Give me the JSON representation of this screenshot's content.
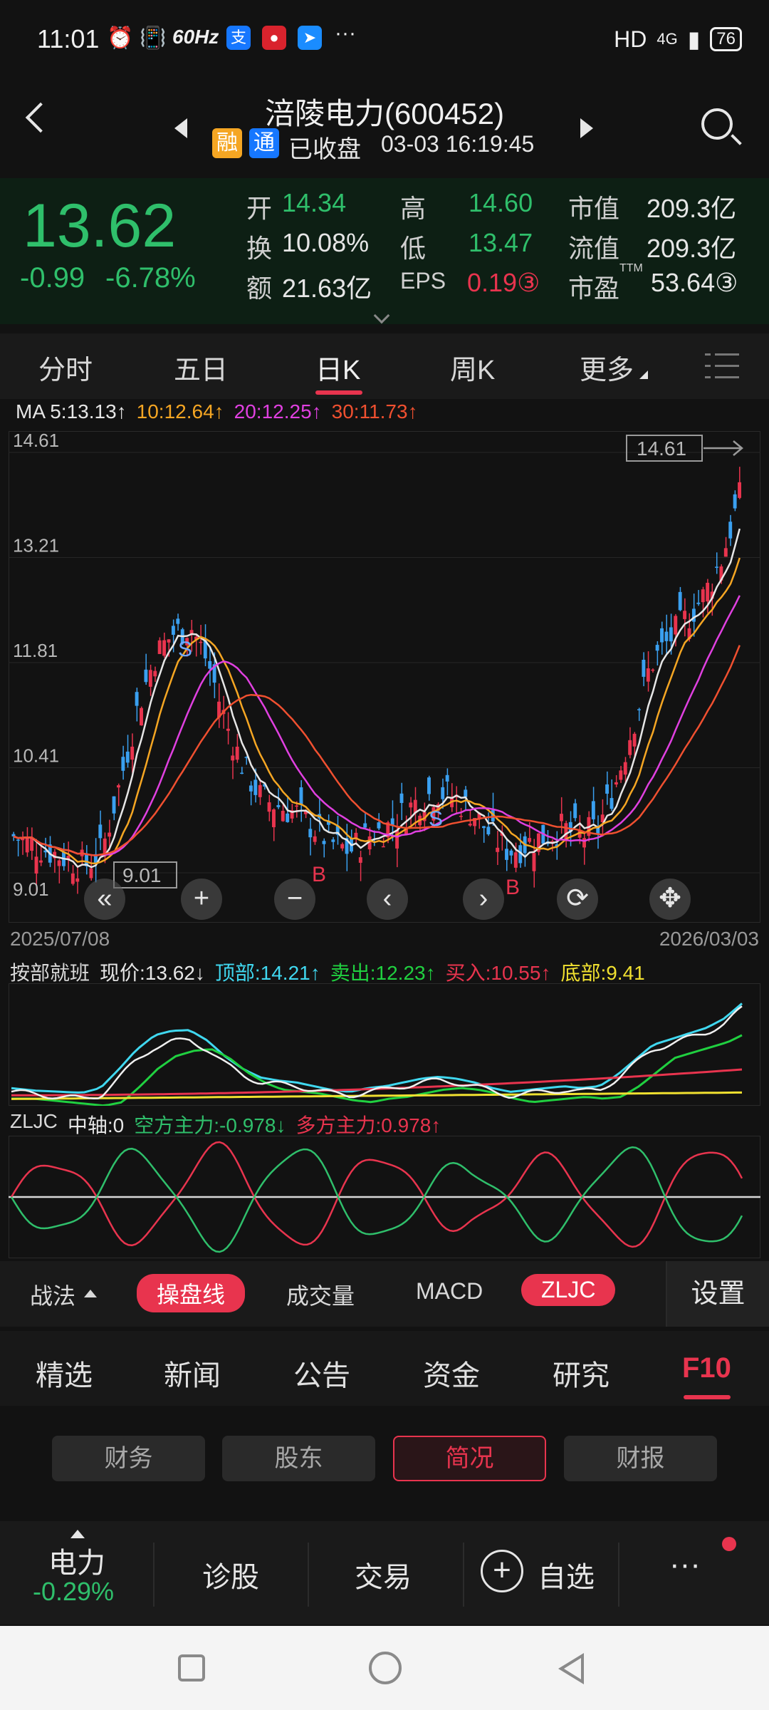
{
  "status_bar": {
    "time": "11:01",
    "hz": "60Hz",
    "network": "HD",
    "signal": "4G",
    "battery": "76",
    "more": "···"
  },
  "header": {
    "name_code": "涪陵电力(600452)",
    "tag_rong": "融",
    "tag_tong": "通",
    "status": "已收盘",
    "datetime": "03-03 16:19:45"
  },
  "quote": {
    "price": "13.62",
    "change": "-0.99",
    "change_pct": "-6.78%",
    "open_label": "开",
    "open": "14.34",
    "high_label": "高",
    "high": "14.60",
    "mktcap_label": "市值",
    "mktcap": "209.3亿",
    "turnover_label": "换",
    "turnover": "10.08%",
    "low_label": "低",
    "low": "13.47",
    "float_label": "流值",
    "float": "209.3亿",
    "amount_label": "额",
    "amount": "21.63亿",
    "eps_label": "EPS",
    "eps": "0.19③",
    "pe_label": "市盈",
    "pe_sup": "TTM",
    "pe": "53.64③"
  },
  "periods": [
    "分时",
    "五日",
    "日K",
    "周K",
    "更多"
  ],
  "ma": {
    "ma5": "MA 5:13.13↑",
    "ma10": "10:12.64↑",
    "ma20": "20:12.25↑",
    "ma30": "30:11.73↑"
  },
  "chart_data": {
    "type": "candlestick",
    "y_ticks": [
      "14.61",
      "13.21",
      "11.81",
      "10.41",
      "9.01"
    ],
    "ylim": [
      9.01,
      14.61
    ],
    "x_labels": [
      "2025/07/08",
      "2026/03/03"
    ],
    "max_marker": "14.61",
    "min_marker": "9.01",
    "signals": [
      "S",
      "B",
      "S",
      "B"
    ],
    "ma_close_approx": [
      9.5,
      9.4,
      9.3,
      9.2,
      9.1,
      9.3,
      10.2,
      11.2,
      11.9,
      12.2,
      12.3,
      11.8,
      11.0,
      10.4,
      10.0,
      9.9,
      9.8,
      9.6,
      9.4,
      9.3,
      9.5,
      9.6,
      9.8,
      10.0,
      10.1,
      10.0,
      9.8,
      9.5,
      9.3,
      9.4,
      9.5,
      9.6,
      9.5,
      9.6,
      10.2,
      11.0,
      11.8,
      12.1,
      12.4,
      12.7,
      13.2,
      14.0
    ]
  },
  "indicator1": {
    "name": "按部就班",
    "price": "现价:13.62↓",
    "top": "顶部:14.21↑",
    "sell": "卖出:12.23↑",
    "buy": "买入:10.55↑",
    "bottom": "底部:9.41"
  },
  "indicator2": {
    "name": "ZLJC",
    "mid": "中轴:0",
    "short": "空方主力:-0.978↓",
    "long": "多方主力:0.978↑"
  },
  "indicator_tabs": {
    "strategy": "战法",
    "tabs": [
      "操盘线",
      "成交量",
      "MACD",
      "ZLJC"
    ],
    "settings": "设置"
  },
  "content_tabs": [
    "精选",
    "新闻",
    "公告",
    "资金",
    "研究",
    "F10"
  ],
  "sub_tabs": [
    "财务",
    "股东",
    "简况",
    "财报"
  ],
  "bottom_nav": {
    "sector_name": "电力",
    "sector_change": "-0.29%",
    "diagnose": "诊股",
    "trade": "交易",
    "watchlist": "自选",
    "more": "···"
  },
  "colors": {
    "up": "#e8344e",
    "down": "#2fbf6b",
    "accent": "#e8344e",
    "ma5": "#e6e6e6",
    "ma10": "#f5a623",
    "ma20": "#e040e0",
    "ma30": "#f05030"
  }
}
